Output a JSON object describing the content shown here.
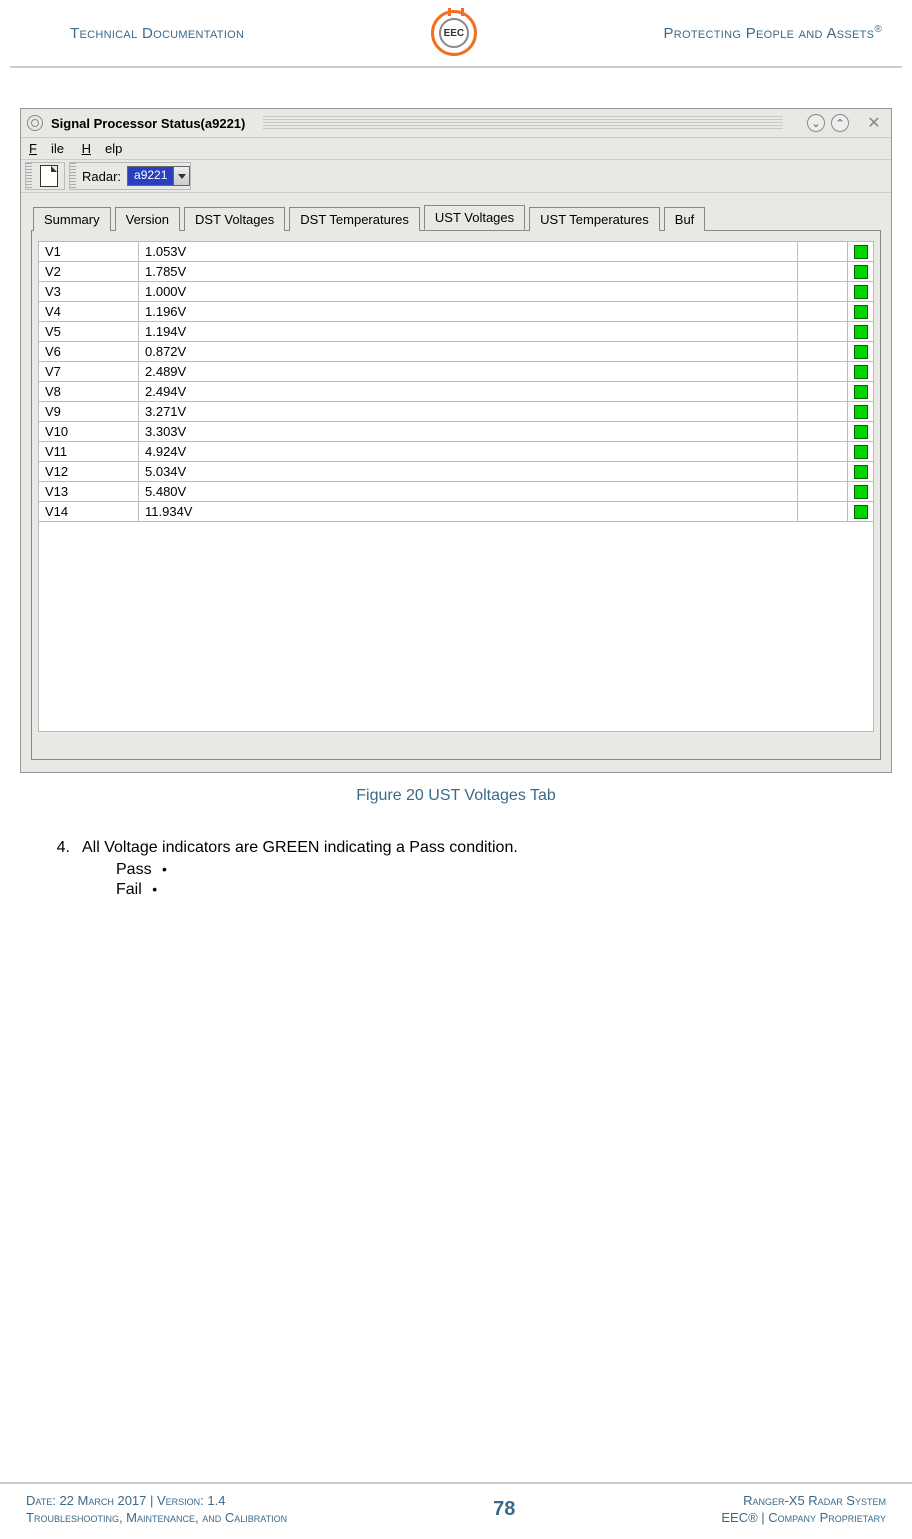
{
  "header": {
    "left": "Technical Documentation",
    "logo_text": "EEC",
    "right": "Protecting People and Assets",
    "right_mark": "®"
  },
  "app": {
    "title": "Signal Processor Status(a9221)",
    "menubar": {
      "file": "File",
      "help": "Help"
    },
    "toolbar": {
      "radar_label": "Radar:",
      "radar_value": "a9221"
    },
    "tabs": {
      "summary": "Summary",
      "version": "Version",
      "dst_voltages": "DST Voltages",
      "dst_temperatures": "DST Temperatures",
      "ust_voltages": "UST Voltages",
      "ust_temperatures": "UST Temperatures",
      "buf": "Buf"
    },
    "voltages": [
      {
        "name": "V1",
        "value": "1.053V"
      },
      {
        "name": "V2",
        "value": "1.785V"
      },
      {
        "name": "V3",
        "value": "1.000V"
      },
      {
        "name": "V4",
        "value": "1.196V"
      },
      {
        "name": "V5",
        "value": "1.194V"
      },
      {
        "name": "V6",
        "value": "0.872V"
      },
      {
        "name": "V7",
        "value": "2.489V"
      },
      {
        "name": "V8",
        "value": "2.494V"
      },
      {
        "name": "V9",
        "value": "3.271V"
      },
      {
        "name": "V10",
        "value": "3.303V"
      },
      {
        "name": "V11",
        "value": "4.924V"
      },
      {
        "name": "V12",
        "value": "5.034V"
      },
      {
        "name": "V13",
        "value": "5.480V"
      },
      {
        "name": "V14",
        "value": "11.934V"
      }
    ]
  },
  "caption": "Figure 20 UST Voltages Tab",
  "body": {
    "item_num": "4.",
    "item_text": "All Voltage indicators are GREEN indicating a Pass condition.",
    "pass_label": "Pass",
    "fail_label": "Fail",
    "bullet": "•"
  },
  "footer": {
    "left_line1": "Date: 22 March 2017 | Version: 1.4",
    "left_line2": "Troubleshooting, Maintenance, and Calibration",
    "page": "78",
    "right_line1": "Ranger-X5 Radar System",
    "right_line2": "EEC® | Company Proprietary"
  },
  "colors": {
    "status_ok": "#00d400"
  }
}
